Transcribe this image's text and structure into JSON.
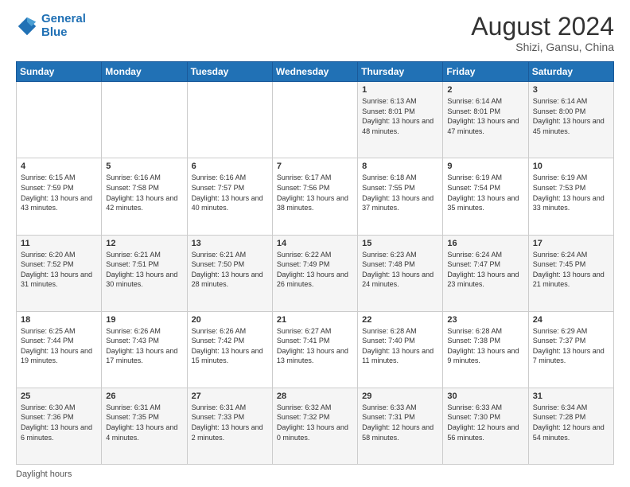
{
  "logo": {
    "line1": "General",
    "line2": "Blue"
  },
  "title": "August 2024",
  "location": "Shizi, Gansu, China",
  "days_of_week": [
    "Sunday",
    "Monday",
    "Tuesday",
    "Wednesday",
    "Thursday",
    "Friday",
    "Saturday"
  ],
  "footer": "Daylight hours",
  "weeks": [
    [
      {
        "day": "",
        "sunrise": "",
        "sunset": "",
        "daylight": ""
      },
      {
        "day": "",
        "sunrise": "",
        "sunset": "",
        "daylight": ""
      },
      {
        "day": "",
        "sunrise": "",
        "sunset": "",
        "daylight": ""
      },
      {
        "day": "",
        "sunrise": "",
        "sunset": "",
        "daylight": ""
      },
      {
        "day": "1",
        "sunrise": "Sunrise: 6:13 AM",
        "sunset": "Sunset: 8:01 PM",
        "daylight": "Daylight: 13 hours and 48 minutes."
      },
      {
        "day": "2",
        "sunrise": "Sunrise: 6:14 AM",
        "sunset": "Sunset: 8:01 PM",
        "daylight": "Daylight: 13 hours and 47 minutes."
      },
      {
        "day": "3",
        "sunrise": "Sunrise: 6:14 AM",
        "sunset": "Sunset: 8:00 PM",
        "daylight": "Daylight: 13 hours and 45 minutes."
      }
    ],
    [
      {
        "day": "4",
        "sunrise": "Sunrise: 6:15 AM",
        "sunset": "Sunset: 7:59 PM",
        "daylight": "Daylight: 13 hours and 43 minutes."
      },
      {
        "day": "5",
        "sunrise": "Sunrise: 6:16 AM",
        "sunset": "Sunset: 7:58 PM",
        "daylight": "Daylight: 13 hours and 42 minutes."
      },
      {
        "day": "6",
        "sunrise": "Sunrise: 6:16 AM",
        "sunset": "Sunset: 7:57 PM",
        "daylight": "Daylight: 13 hours and 40 minutes."
      },
      {
        "day": "7",
        "sunrise": "Sunrise: 6:17 AM",
        "sunset": "Sunset: 7:56 PM",
        "daylight": "Daylight: 13 hours and 38 minutes."
      },
      {
        "day": "8",
        "sunrise": "Sunrise: 6:18 AM",
        "sunset": "Sunset: 7:55 PM",
        "daylight": "Daylight: 13 hours and 37 minutes."
      },
      {
        "day": "9",
        "sunrise": "Sunrise: 6:19 AM",
        "sunset": "Sunset: 7:54 PM",
        "daylight": "Daylight: 13 hours and 35 minutes."
      },
      {
        "day": "10",
        "sunrise": "Sunrise: 6:19 AM",
        "sunset": "Sunset: 7:53 PM",
        "daylight": "Daylight: 13 hours and 33 minutes."
      }
    ],
    [
      {
        "day": "11",
        "sunrise": "Sunrise: 6:20 AM",
        "sunset": "Sunset: 7:52 PM",
        "daylight": "Daylight: 13 hours and 31 minutes."
      },
      {
        "day": "12",
        "sunrise": "Sunrise: 6:21 AM",
        "sunset": "Sunset: 7:51 PM",
        "daylight": "Daylight: 13 hours and 30 minutes."
      },
      {
        "day": "13",
        "sunrise": "Sunrise: 6:21 AM",
        "sunset": "Sunset: 7:50 PM",
        "daylight": "Daylight: 13 hours and 28 minutes."
      },
      {
        "day": "14",
        "sunrise": "Sunrise: 6:22 AM",
        "sunset": "Sunset: 7:49 PM",
        "daylight": "Daylight: 13 hours and 26 minutes."
      },
      {
        "day": "15",
        "sunrise": "Sunrise: 6:23 AM",
        "sunset": "Sunset: 7:48 PM",
        "daylight": "Daylight: 13 hours and 24 minutes."
      },
      {
        "day": "16",
        "sunrise": "Sunrise: 6:24 AM",
        "sunset": "Sunset: 7:47 PM",
        "daylight": "Daylight: 13 hours and 23 minutes."
      },
      {
        "day": "17",
        "sunrise": "Sunrise: 6:24 AM",
        "sunset": "Sunset: 7:45 PM",
        "daylight": "Daylight: 13 hours and 21 minutes."
      }
    ],
    [
      {
        "day": "18",
        "sunrise": "Sunrise: 6:25 AM",
        "sunset": "Sunset: 7:44 PM",
        "daylight": "Daylight: 13 hours and 19 minutes."
      },
      {
        "day": "19",
        "sunrise": "Sunrise: 6:26 AM",
        "sunset": "Sunset: 7:43 PM",
        "daylight": "Daylight: 13 hours and 17 minutes."
      },
      {
        "day": "20",
        "sunrise": "Sunrise: 6:26 AM",
        "sunset": "Sunset: 7:42 PM",
        "daylight": "Daylight: 13 hours and 15 minutes."
      },
      {
        "day": "21",
        "sunrise": "Sunrise: 6:27 AM",
        "sunset": "Sunset: 7:41 PM",
        "daylight": "Daylight: 13 hours and 13 minutes."
      },
      {
        "day": "22",
        "sunrise": "Sunrise: 6:28 AM",
        "sunset": "Sunset: 7:40 PM",
        "daylight": "Daylight: 13 hours and 11 minutes."
      },
      {
        "day": "23",
        "sunrise": "Sunrise: 6:28 AM",
        "sunset": "Sunset: 7:38 PM",
        "daylight": "Daylight: 13 hours and 9 minutes."
      },
      {
        "day": "24",
        "sunrise": "Sunrise: 6:29 AM",
        "sunset": "Sunset: 7:37 PM",
        "daylight": "Daylight: 13 hours and 7 minutes."
      }
    ],
    [
      {
        "day": "25",
        "sunrise": "Sunrise: 6:30 AM",
        "sunset": "Sunset: 7:36 PM",
        "daylight": "Daylight: 13 hours and 6 minutes."
      },
      {
        "day": "26",
        "sunrise": "Sunrise: 6:31 AM",
        "sunset": "Sunset: 7:35 PM",
        "daylight": "Daylight: 13 hours and 4 minutes."
      },
      {
        "day": "27",
        "sunrise": "Sunrise: 6:31 AM",
        "sunset": "Sunset: 7:33 PM",
        "daylight": "Daylight: 13 hours and 2 minutes."
      },
      {
        "day": "28",
        "sunrise": "Sunrise: 6:32 AM",
        "sunset": "Sunset: 7:32 PM",
        "daylight": "Daylight: 13 hours and 0 minutes."
      },
      {
        "day": "29",
        "sunrise": "Sunrise: 6:33 AM",
        "sunset": "Sunset: 7:31 PM",
        "daylight": "Daylight: 12 hours and 58 minutes."
      },
      {
        "day": "30",
        "sunrise": "Sunrise: 6:33 AM",
        "sunset": "Sunset: 7:30 PM",
        "daylight": "Daylight: 12 hours and 56 minutes."
      },
      {
        "day": "31",
        "sunrise": "Sunrise: 6:34 AM",
        "sunset": "Sunset: 7:28 PM",
        "daylight": "Daylight: 12 hours and 54 minutes."
      }
    ]
  ]
}
